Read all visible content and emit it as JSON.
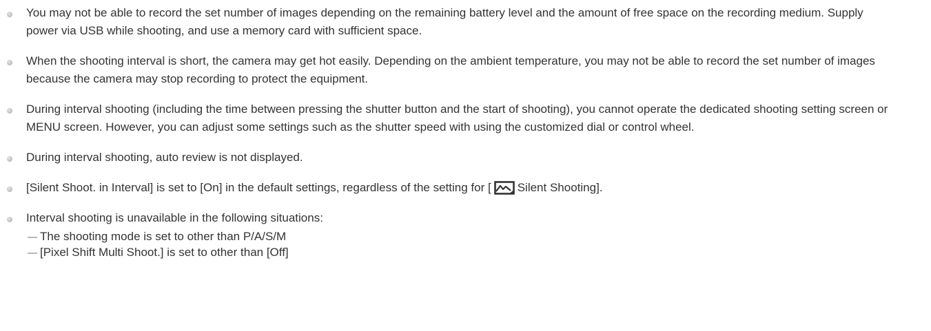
{
  "notes": [
    {
      "text": "You may not be able to record the set number of images depending on the remaining battery level and the amount of free space on the recording medium. Supply power via USB while shooting, and use a memory card with sufficient space."
    },
    {
      "text": "When the shooting interval is short, the camera may get hot easily. Depending on the ambient temperature, you may not be able to record the set number of images because the camera may stop recording to protect the equipment."
    },
    {
      "text": "During interval shooting (including the time between pressing the shutter button and the start of shooting), you cannot operate the dedicated shooting setting screen or MENU screen. However, you can adjust some settings such as the shutter speed with using the customized dial or control wheel."
    },
    {
      "text": "During interval shooting, auto review is not displayed."
    },
    {
      "text_before_icon": "[Silent Shoot. in Interval] is set to [On] in the default settings, regardless of the setting for [",
      "icon": "still-image-mode-icon",
      "text_after_icon": "Silent Shooting]."
    },
    {
      "text": "Interval shooting is unavailable in the following situations:",
      "sub_items": [
        "The shooting mode is set to other than P/A/S/M",
        "[Pixel Shift Multi Shoot.] is set to other than [Off]"
      ]
    }
  ],
  "colors": {
    "text": "#333333",
    "bullet": "#c2c2c2",
    "dash": "#b5b5b5"
  }
}
